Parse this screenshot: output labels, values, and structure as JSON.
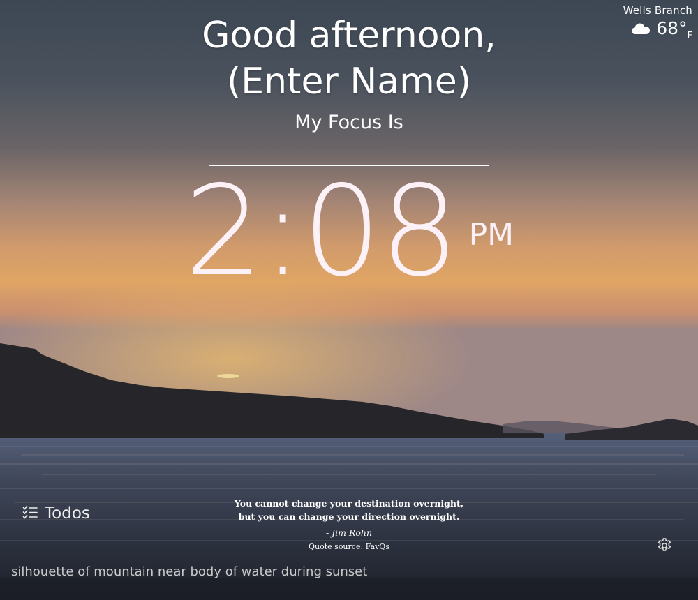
{
  "background": {
    "description_label": "silhouette of mountain near body of water during sunset"
  },
  "weather": {
    "location": "Wells Branch",
    "temperature": "68°",
    "unit": "F",
    "icon": "cloud-icon"
  },
  "greeting": {
    "line1": "Good afternoon,",
    "line2": "(Enter Name)"
  },
  "focus": {
    "label": "My Focus Is",
    "value": ""
  },
  "clock": {
    "time": "2:08",
    "ampm": "PM"
  },
  "todos": {
    "label": "Todos",
    "icon": "checklist-icon"
  },
  "quote": {
    "text": "You cannot change your destination overnight, but you can change your direction overnight.",
    "author": "- Jim Rohn",
    "source": "Quote source: FavQs"
  },
  "settings": {
    "icon": "gear-icon"
  },
  "colors": {
    "text": "#ffffff",
    "clock": "#fbf1f6"
  }
}
